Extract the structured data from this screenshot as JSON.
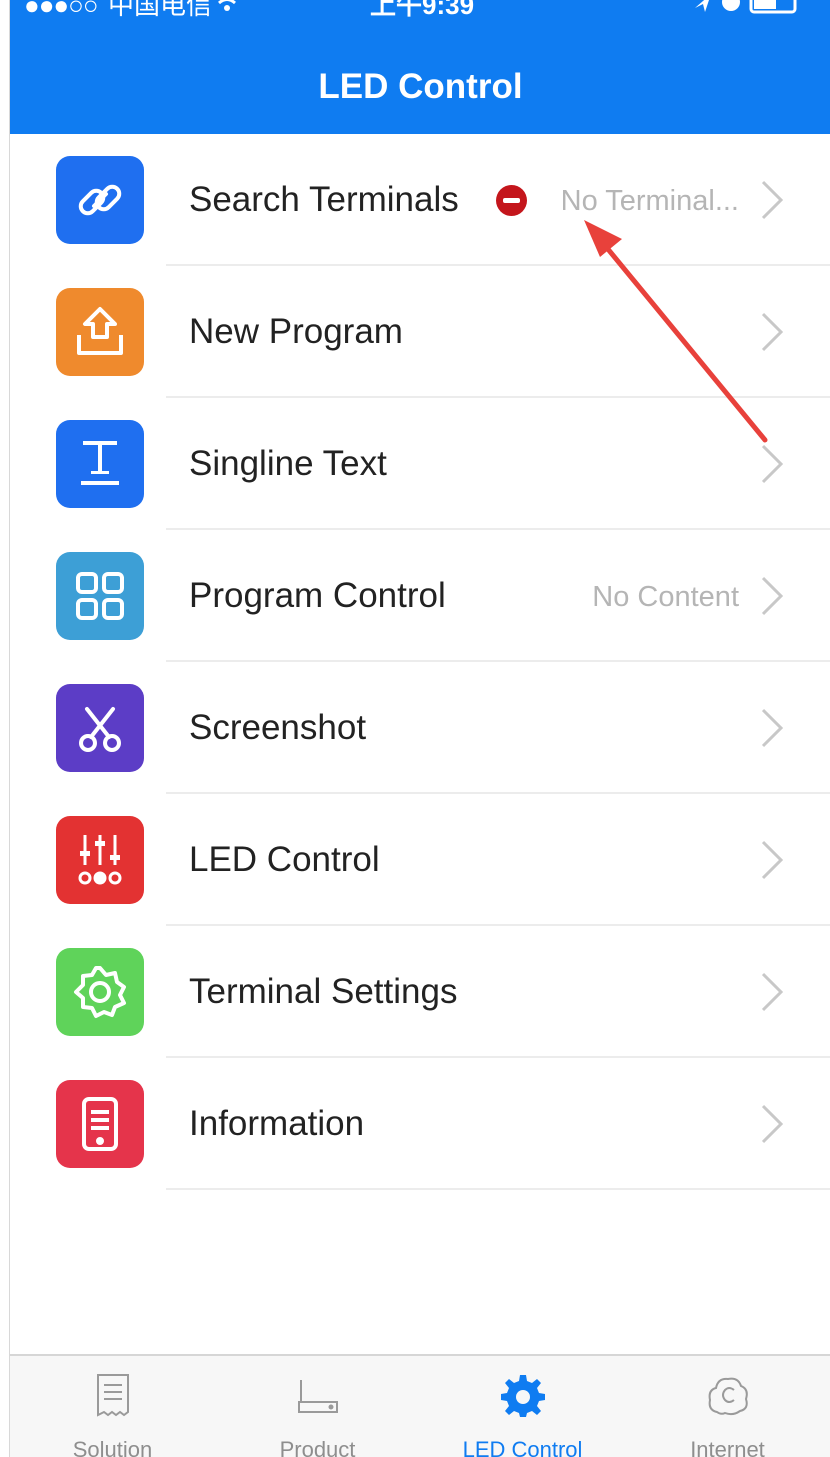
{
  "status_bar": {
    "signal": "●●●○○",
    "carrier": "中国电信",
    "wifi_icon": "wifi-icon",
    "time": "上午9:39",
    "right_icons": "location-icon alarm-icon battery-icon"
  },
  "nav": {
    "title": "LED Control"
  },
  "menu": {
    "items": [
      {
        "label": "Search Terminals",
        "value": "No Terminal...",
        "icon": "link-icon",
        "color": "#1f6ff0"
      },
      {
        "label": "New Program",
        "value": "",
        "icon": "upload-icon",
        "color": "#ef8a2d"
      },
      {
        "label": "Singline Text",
        "value": "",
        "icon": "text-icon",
        "color": "#1f6ff0"
      },
      {
        "label": "Program Control",
        "value": "No Content",
        "icon": "grid-icon",
        "color": "#3d9fd6"
      },
      {
        "label": "Screenshot",
        "value": "",
        "icon": "scissors-icon",
        "color": "#5c3dc6"
      },
      {
        "label": "LED Control",
        "value": "",
        "icon": "sliders-icon",
        "color": "#e33232"
      },
      {
        "label": "Terminal Settings",
        "value": "",
        "icon": "gear-icon",
        "color": "#5fd35a"
      },
      {
        "label": "Information",
        "value": "",
        "icon": "tablet-icon",
        "color": "#e5344b"
      }
    ]
  },
  "tabbar": {
    "tabs": [
      {
        "label": "Solution",
        "icon": "document-icon",
        "active": false
      },
      {
        "label": "Product",
        "icon": "device-icon",
        "active": false
      },
      {
        "label": "LED Control",
        "icon": "gear-icon",
        "active": true
      },
      {
        "label": "Internet",
        "icon": "cloud-c-icon",
        "active": false
      }
    ]
  },
  "colors": {
    "accent": "#0f7cf1",
    "error": "#c4161c",
    "annotation_arrow": "#e8413b"
  }
}
